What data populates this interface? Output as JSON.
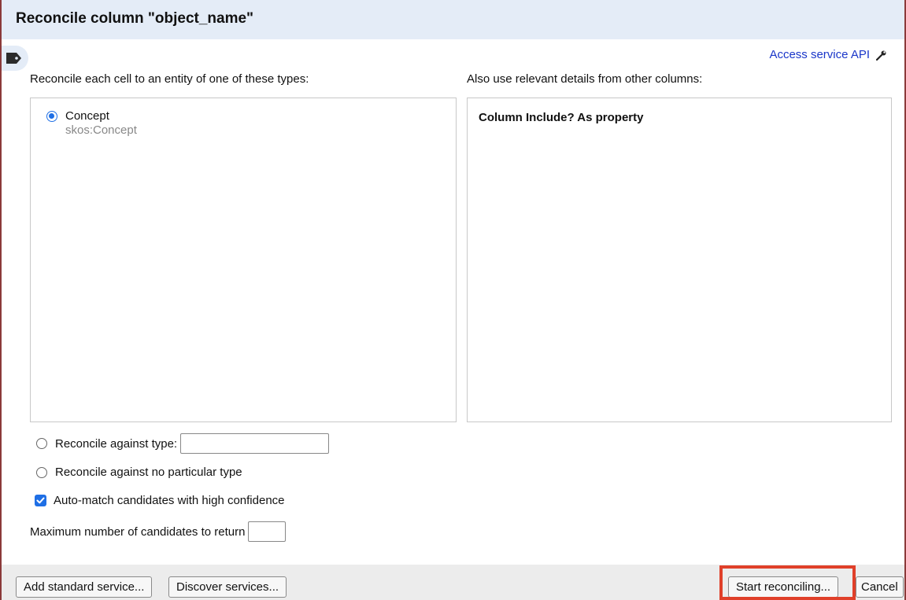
{
  "dialog": {
    "title": "Reconcile column \"object_name\"",
    "access_api_label": "Access service API"
  },
  "types_section": {
    "label": "Reconcile each cell to an entity of one of these types:",
    "types": [
      {
        "name": "Concept",
        "id": "skos:Concept",
        "selected": true
      }
    ]
  },
  "columns_section": {
    "label": "Also use relevant details from other columns:",
    "header": "Column Include? As property"
  },
  "options": {
    "against_type_label": "Reconcile against type:",
    "against_type_value": "",
    "no_type_label": "Reconcile against no particular type",
    "auto_match_label": "Auto-match candidates with high confidence",
    "auto_match_checked": true,
    "max_candidates_label": "Maximum number of candidates to return",
    "max_candidates_value": ""
  },
  "footer": {
    "add_service_label": "Add standard service...",
    "discover_label": "Discover services...",
    "start_label": "Start reconciling...",
    "cancel_label": "Cancel"
  },
  "colors": {
    "accent": "#1f6fe5",
    "link": "#1a36c9",
    "highlight": "#e0402a",
    "titlebar_bg": "#e4ecf7"
  }
}
